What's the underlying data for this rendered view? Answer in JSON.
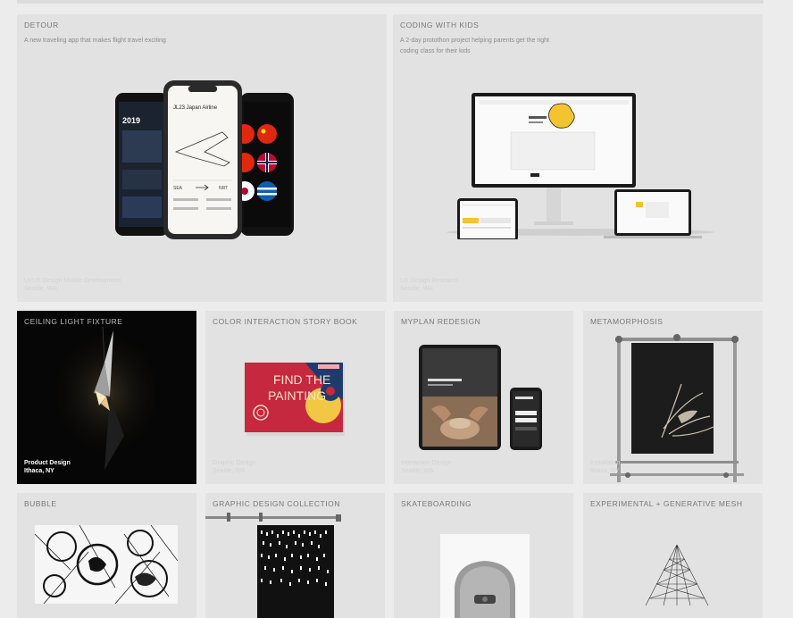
{
  "projects": {
    "detour": {
      "title": "DETOUR",
      "desc": "A new traveling app that makes flight travel exciting",
      "tags": "UI/UX Design  Mobile Development",
      "location": "Seattle, WA",
      "year": "2019",
      "flight": "JL23 Japan Airline"
    },
    "coding": {
      "title": "CODING WITH KIDS",
      "desc_line1": "A 2-day protothon project helping parents get the right",
      "desc_line2": "coding class for their kids",
      "tags": "UX Design  Research",
      "location": "Seattle, WA"
    },
    "ceiling": {
      "title": "CEILING LIGHT FIXTURE",
      "tags": "Product Design",
      "location": "Ithaca, NY"
    },
    "color": {
      "title": "COLOR INTERACTION STORY BOOK",
      "tags": "Graphic Design",
      "location": "Seattle, WA",
      "book_line1": "FIND THE",
      "book_line2": "PAINTING"
    },
    "myplan": {
      "title": "MYPLAN REDESIGN",
      "tags": "Interaction Design",
      "location": "Seattle, WA"
    },
    "metamorphosis": {
      "title": "METAMORPHOSIS",
      "tags": "Installation",
      "location": "Ithaca, NY"
    },
    "bubble": {
      "title": "BUBBLE"
    },
    "graphic": {
      "title": "GRAPHIC DESIGN COLLECTION"
    },
    "skate": {
      "title": "SKATEBOARDING"
    },
    "mesh": {
      "title": "EXPERIMENTAL + GENERATIVE MESH"
    }
  }
}
